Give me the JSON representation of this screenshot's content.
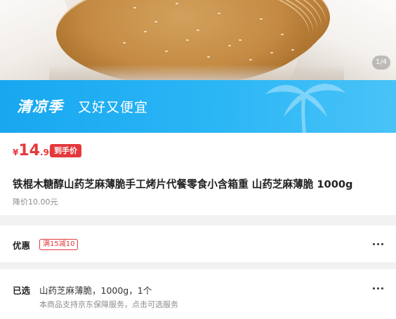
{
  "hero": {
    "page_indicator": "1/4"
  },
  "banner": {
    "tag": "清凉季",
    "slogan": "又好又便宜",
    "background_color": "#1aa8f0"
  },
  "price": {
    "currency": "¥",
    "integer": "14",
    "decimal": ".90",
    "badge": "到手价",
    "color": "#e4393c"
  },
  "product": {
    "title": "铁棍木糖醇山药芝麻薄脆手工烤片代餐零食小含箱重 山药芝麻薄脆 1000g",
    "price_drop": "降价10.00元"
  },
  "coupon": {
    "label": "优惠",
    "tag": "满15减10"
  },
  "selection": {
    "label": "已选",
    "value": "山药芝麻薄脆，1000g，1个",
    "note": "本商品支持京东保障服务，点击可选服务"
  }
}
